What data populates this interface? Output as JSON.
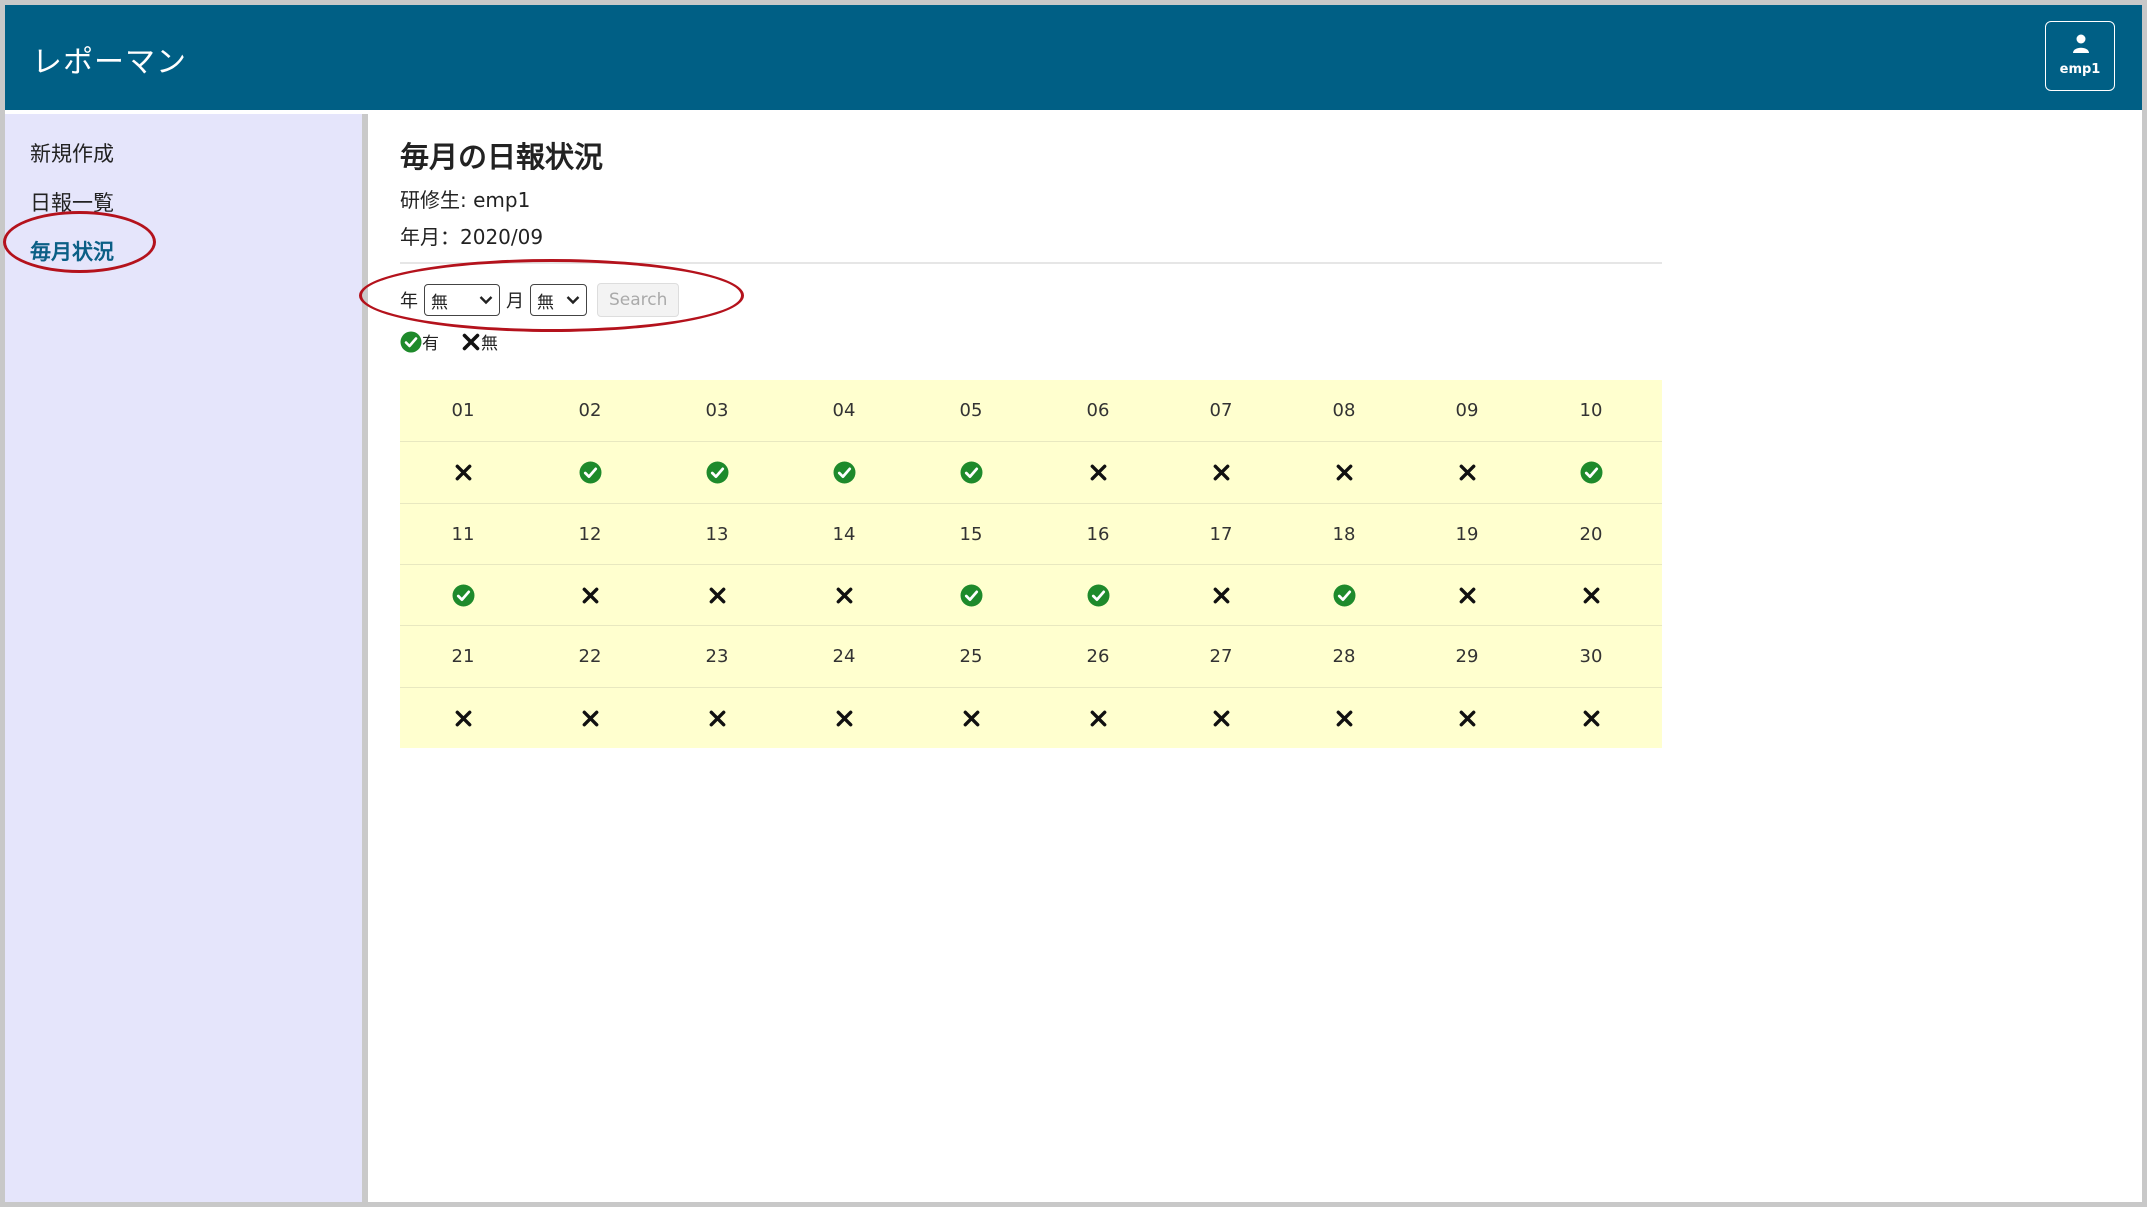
{
  "app": {
    "title": "レポーマン",
    "user": "emp1"
  },
  "sidebar": {
    "items": [
      {
        "label": "新規作成",
        "active": false
      },
      {
        "label": "日報一覧",
        "active": false
      },
      {
        "label": "毎月状況",
        "active": true
      }
    ]
  },
  "main": {
    "title": "毎月の日報状況",
    "trainee": "研修生: emp1",
    "year_month": "年月：2020/09",
    "filter": {
      "year_label": "年",
      "year_value": "無",
      "month_label": "月",
      "month_value": "無",
      "search_label": "Search"
    },
    "legend": {
      "yes_label": "有",
      "no_label": "無"
    },
    "calendar": [
      {
        "days": [
          "01",
          "02",
          "03",
          "04",
          "05",
          "06",
          "07",
          "08",
          "09",
          "10"
        ],
        "status": [
          false,
          true,
          true,
          true,
          true,
          false,
          false,
          false,
          false,
          true
        ]
      },
      {
        "days": [
          "11",
          "12",
          "13",
          "14",
          "15",
          "16",
          "17",
          "18",
          "19",
          "20"
        ],
        "status": [
          true,
          false,
          false,
          false,
          true,
          true,
          false,
          true,
          false,
          false
        ]
      },
      {
        "days": [
          "21",
          "22",
          "23",
          "24",
          "25",
          "26",
          "27",
          "28",
          "29",
          "30"
        ],
        "status": [
          false,
          false,
          false,
          false,
          false,
          false,
          false,
          false,
          false,
          false
        ]
      }
    ]
  },
  "colors": {
    "navbar": "#005f85",
    "sidebar": "#e5e5fb",
    "table": "#ffffcf",
    "check": "#1e8a2b",
    "annotation": "#b4121c"
  }
}
